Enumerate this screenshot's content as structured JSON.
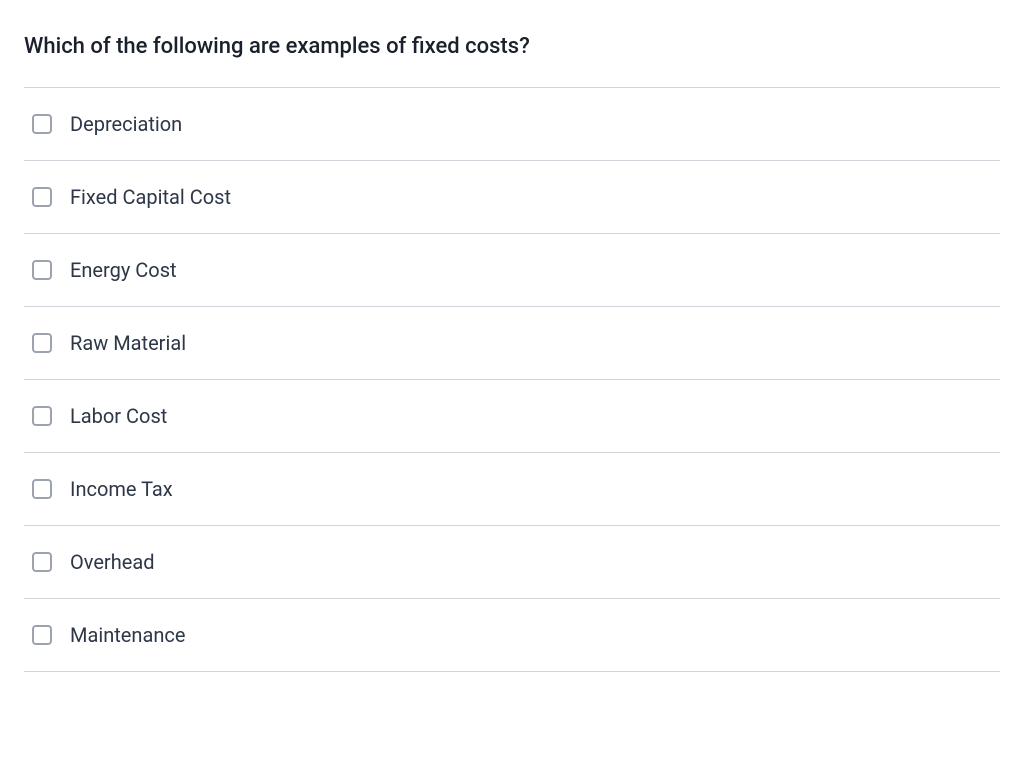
{
  "question": {
    "title": "Which of the following are examples of fixed costs?"
  },
  "options": [
    {
      "id": "depreciation",
      "label": "Depreciation"
    },
    {
      "id": "fixed-capital-cost",
      "label": "Fixed Capital Cost"
    },
    {
      "id": "energy-cost",
      "label": "Energy Cost"
    },
    {
      "id": "raw-material",
      "label": "Raw Material"
    },
    {
      "id": "labor-cost",
      "label": "Labor Cost"
    },
    {
      "id": "income-tax",
      "label": "Income Tax"
    },
    {
      "id": "overhead",
      "label": "Overhead"
    },
    {
      "id": "maintenance",
      "label": "Maintenance"
    }
  ]
}
